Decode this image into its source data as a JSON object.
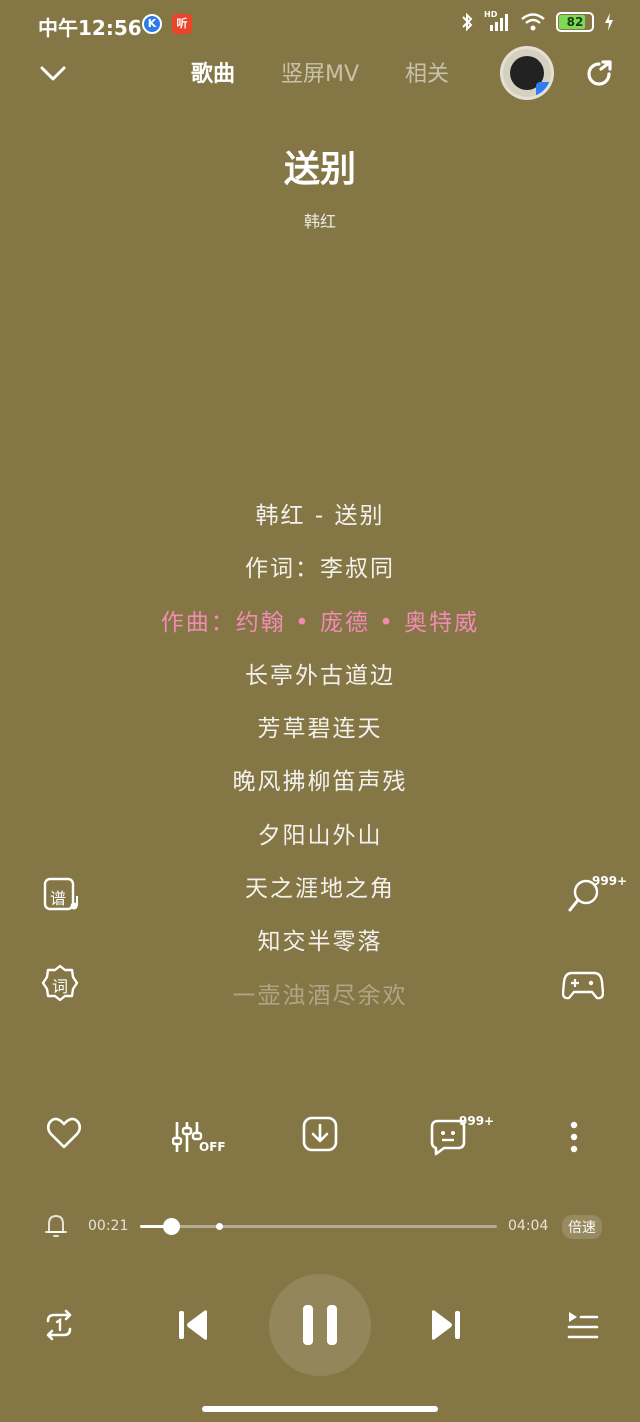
{
  "status_bar": {
    "time": "中午12:56",
    "app_badge_k": "K",
    "app_badge_listen": "听",
    "signal_label": "HD",
    "battery": "82"
  },
  "nav": {
    "tabs": [
      {
        "label": "歌曲",
        "active": true
      },
      {
        "label": "竖屏MV",
        "active": false
      },
      {
        "label": "相关",
        "active": false
      }
    ]
  },
  "song": {
    "title": "送别",
    "artist": "韩红"
  },
  "lyrics": [
    {
      "text": "韩红 - 送别",
      "state": "normal"
    },
    {
      "text": "作词：李叔同",
      "state": "normal"
    },
    {
      "text": "作曲：约翰 • 庞德 • 奥特威",
      "state": "active"
    },
    {
      "text": "长亭外古道边",
      "state": "normal"
    },
    {
      "text": "芳草碧连天",
      "state": "normal"
    },
    {
      "text": "晚风拂柳笛声残",
      "state": "normal"
    },
    {
      "text": "夕阳山外山",
      "state": "normal"
    },
    {
      "text": "天之涯地之角",
      "state": "normal"
    },
    {
      "text": "知交半零落",
      "state": "normal"
    },
    {
      "text": "一壶浊酒尽余欢",
      "state": "fade"
    }
  ],
  "side": {
    "score_label": "谱",
    "lyric_label": "词",
    "sing_count": "999+"
  },
  "actions": {
    "eq_label": "OFF",
    "comment_count": "999+"
  },
  "player": {
    "current_time": "00:21",
    "total_time": "04:04",
    "progress": 0.086,
    "buffered": 0.22,
    "speed_label": "倍速"
  },
  "colors": {
    "background": "#857645",
    "active_lyric": "#f08cb4",
    "battery": "#7ed957"
  }
}
